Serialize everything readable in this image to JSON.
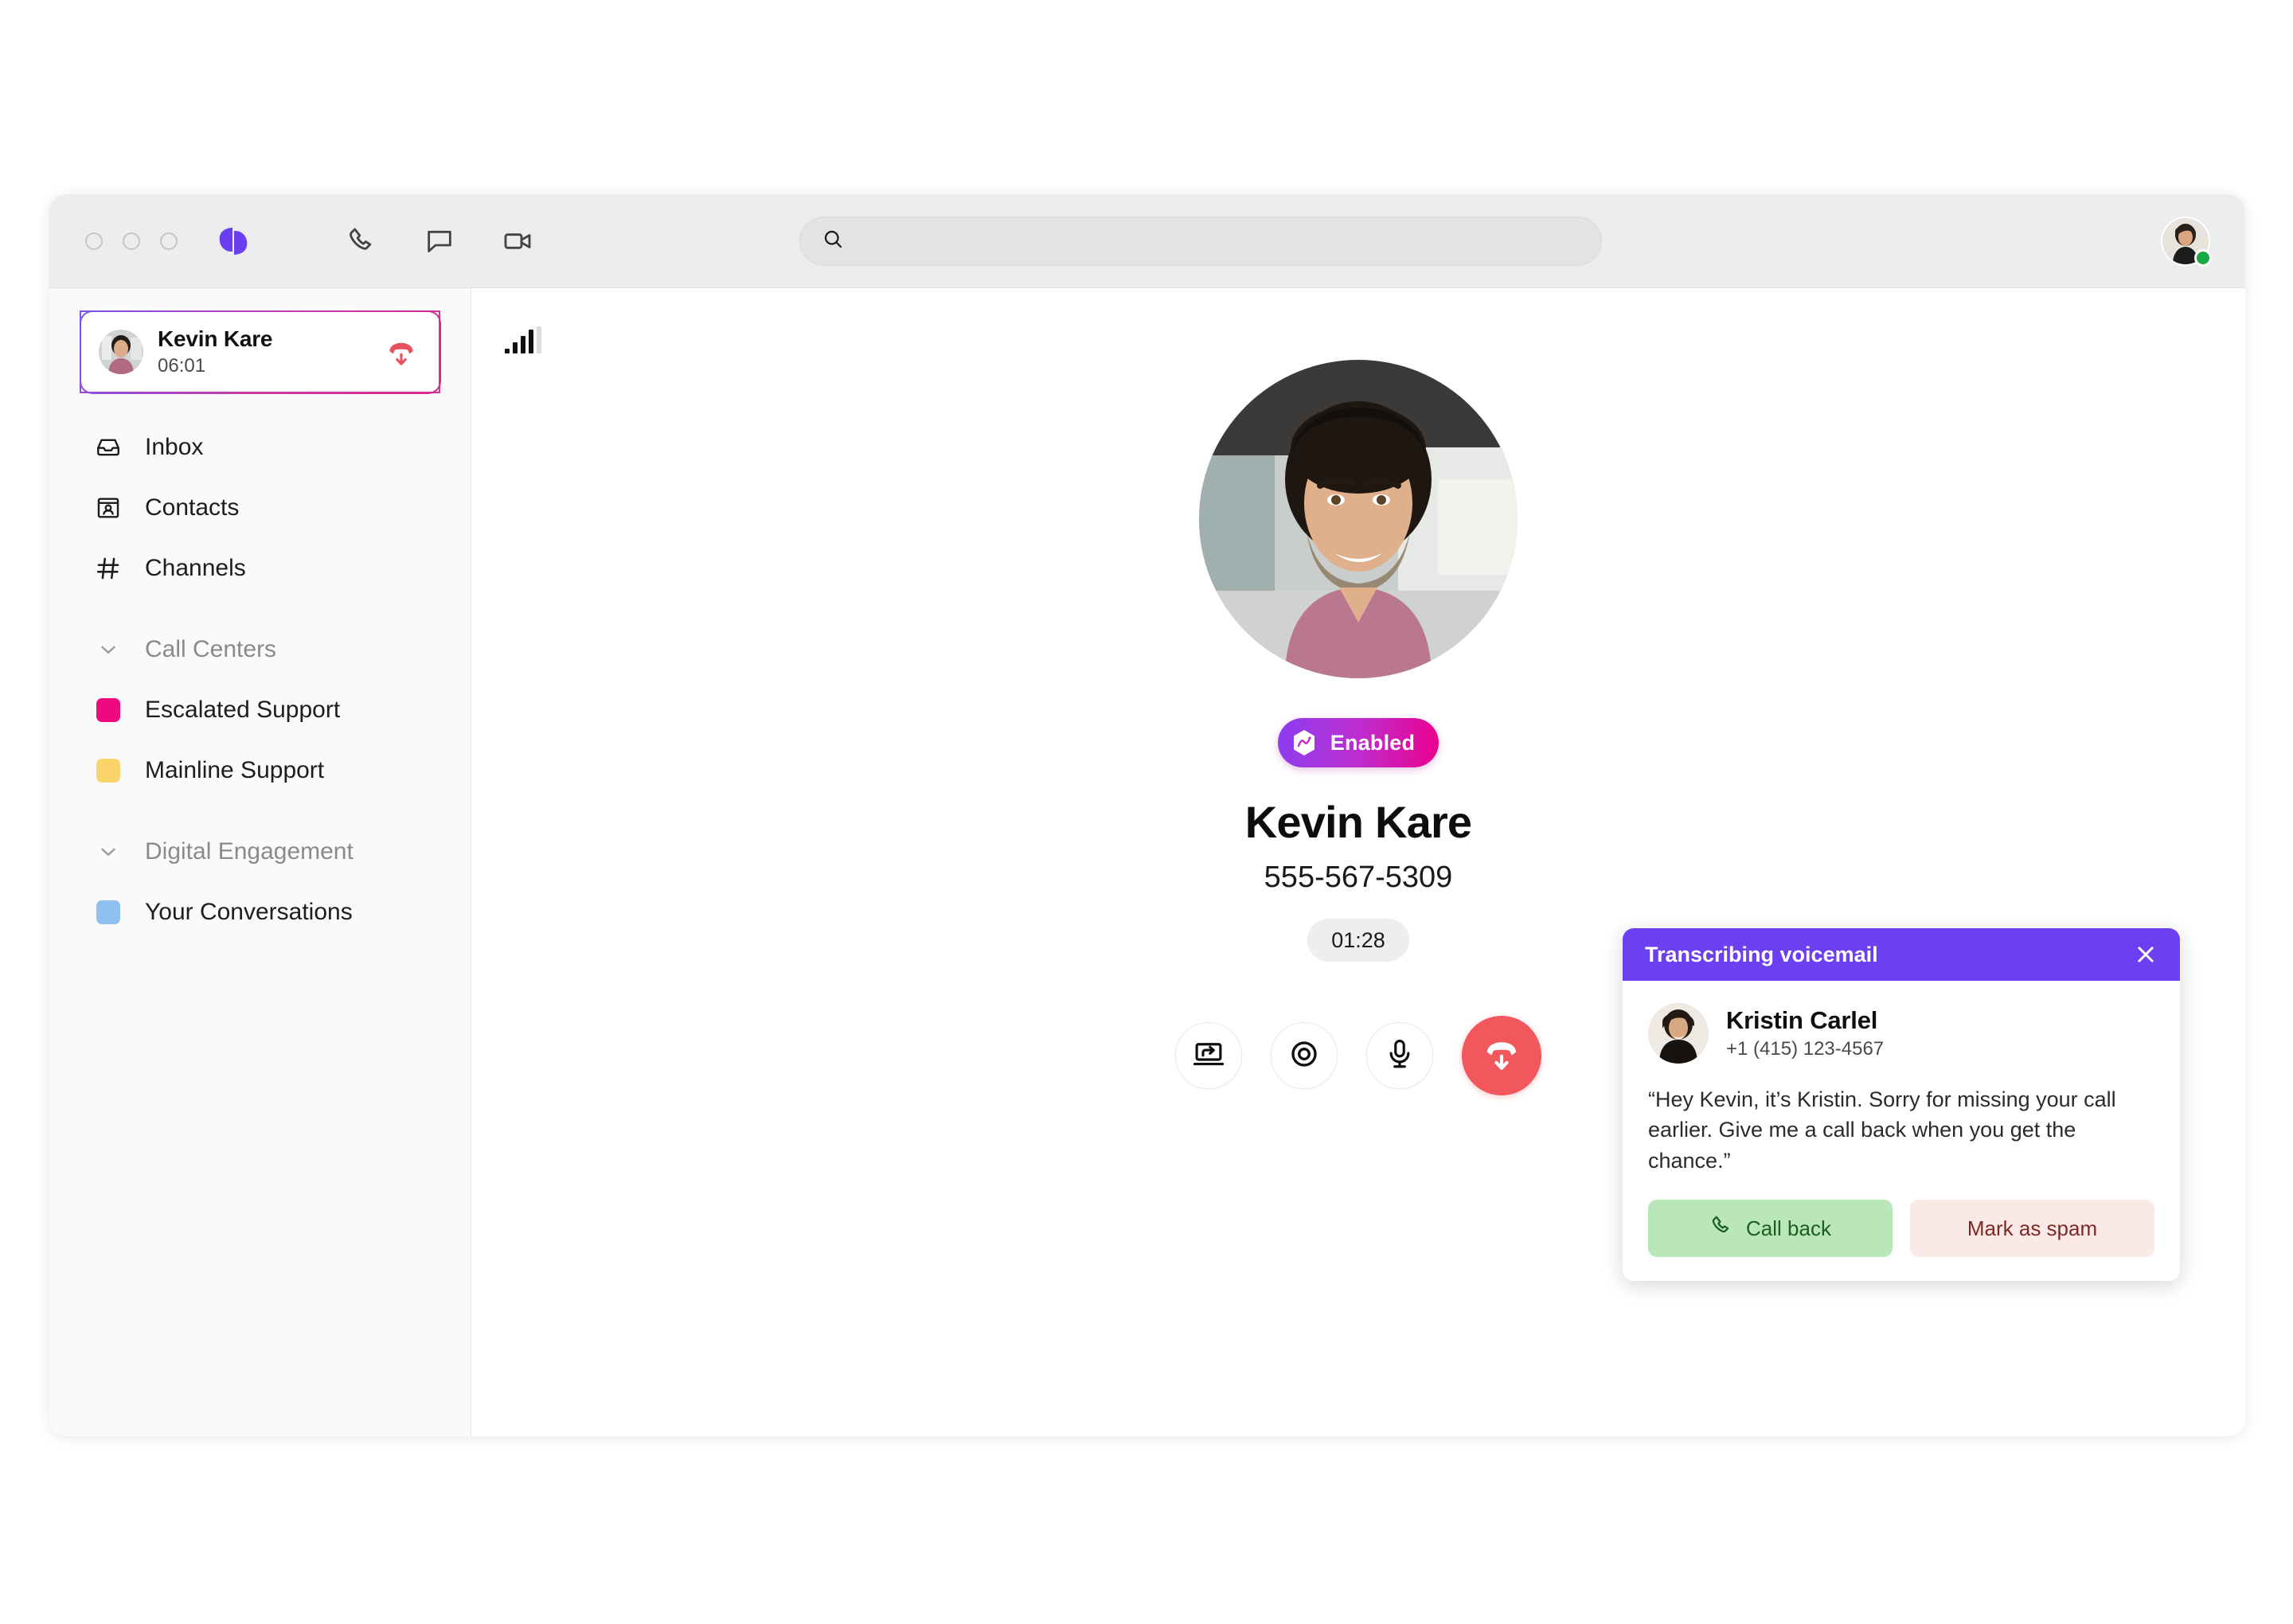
{
  "window": {
    "traffic_lights": [
      "close",
      "minimize",
      "maximize"
    ],
    "brand": "dialpad-logo"
  },
  "titlebar": {
    "actions": [
      {
        "name": "phone-icon",
        "label": "Phone"
      },
      {
        "name": "message-icon",
        "label": "Messages"
      },
      {
        "name": "video-icon",
        "label": "Video"
      }
    ],
    "search": {
      "value": "",
      "placeholder": ""
    },
    "avatar": {
      "name": "user-avatar",
      "status": "online",
      "status_color": "#18a943"
    }
  },
  "sidebar": {
    "active_call": {
      "name": "Kevin Kare",
      "duration": "06:01",
      "hangup_icon": "hangup-icon"
    },
    "nav": [
      {
        "label": "Inbox",
        "icon": "inbox-icon"
      },
      {
        "label": "Contacts",
        "icon": "contacts-icon"
      },
      {
        "label": "Channels",
        "icon": "hash-icon"
      }
    ],
    "sections": [
      {
        "title": "Call Centers",
        "items": [
          {
            "label": "Escalated Support",
            "color": "#ec0a7e"
          },
          {
            "label": "Mainline Support",
            "color": "#fcd46c"
          }
        ]
      },
      {
        "title": "Digital Engagement",
        "items": [
          {
            "label": "Your Conversations",
            "color": "#8fc0f0"
          }
        ]
      }
    ]
  },
  "main": {
    "signal": {
      "bars": 5,
      "active": 4
    },
    "ai_badge": {
      "label": "Enabled",
      "icon": "ai-hexagon-icon"
    },
    "caller": {
      "name": "Kevin Kare",
      "number": "555-567-5309",
      "timer": "01:28"
    },
    "controls": [
      {
        "name": "transfer-button",
        "icon": "transfer-icon"
      },
      {
        "name": "record-button",
        "icon": "record-icon"
      },
      {
        "name": "mute-button",
        "icon": "microphone-icon"
      },
      {
        "name": "end-call-button",
        "icon": "hangup-icon",
        "color": "#f1575c"
      }
    ]
  },
  "voicemail": {
    "header_title": "Transcribing voicemail",
    "header_color": "#6c3ff0",
    "contact": {
      "name": "Kristin Carlel",
      "number": "+1 (415) 123-4567"
    },
    "transcript": "“Hey Kevin, it’s Kristin. Sorry for missing your call earlier. Give me a call back when you get the chance.”",
    "buttons": {
      "callback": "Call back",
      "spam": "Mark as spam"
    }
  }
}
